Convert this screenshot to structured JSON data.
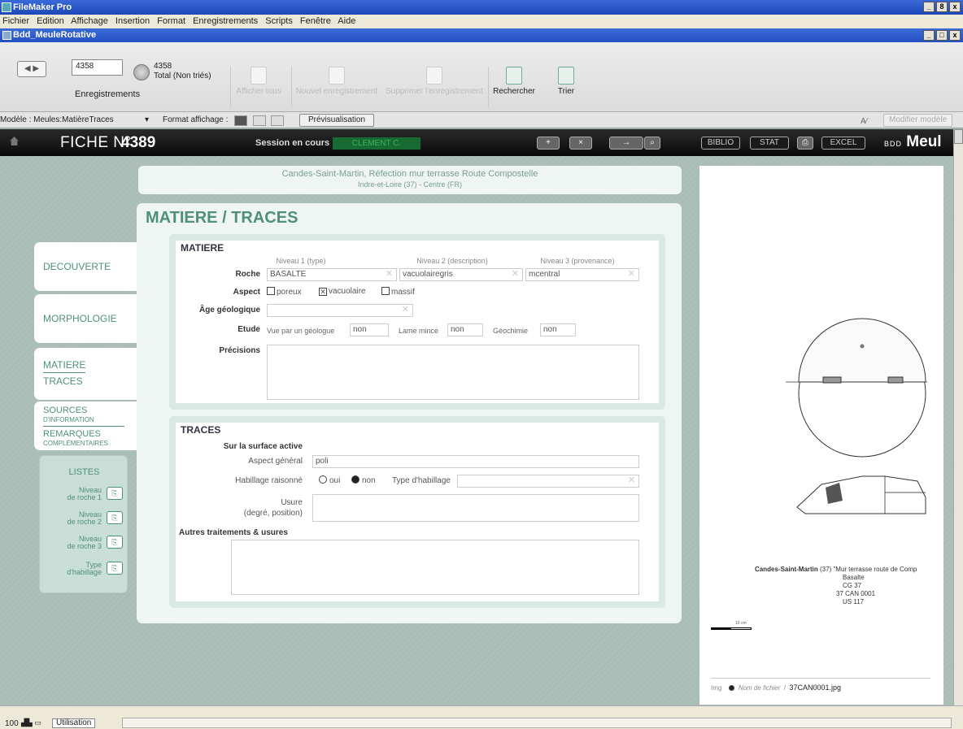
{
  "app": {
    "title": "FileMaker Pro",
    "window_controls": [
      "_",
      "8",
      "x"
    ]
  },
  "menu": [
    "Fichier",
    "Edition",
    "Affichage",
    "Insertion",
    "Format",
    "Enregistrements",
    "Scripts",
    "Fenêtre",
    "Aide"
  ],
  "document": {
    "title": "Bdd_MeuleRotative",
    "window_controls": [
      "_",
      "□",
      "x"
    ]
  },
  "toolbar": {
    "record_input": "4358",
    "records_label": "Enregistrements",
    "total_count": "4358",
    "total_label": "Total (Non triés)",
    "buttons": [
      "Afficher tous",
      "Nouvel enregistrement",
      "Supprimer l'enregistrement",
      "Rechercher",
      "Trier"
    ]
  },
  "layoutbar": {
    "model_label": "Modèle : Meules:MatièreTraces",
    "format_label": "Format affichage :",
    "preview_button": "Prévisualisation",
    "aa_button": "A⁄",
    "edit_layout_button": "Modifier modèle"
  },
  "header": {
    "fiche_label": "FICHE N°",
    "fiche_number": "4389",
    "session_label": "Session en cours :",
    "session_value": "CLEMENT C.",
    "buttons": [
      "BIBLIO",
      "STAT",
      "EXCEL"
    ],
    "brand_prefix": "BDD",
    "brand": "Meul"
  },
  "location": {
    "line1": "Candes-Saint-Martin, Réfection mur terrasse Route Compostelle",
    "line2": "Indre-et-Loire (37) - Centre (FR)"
  },
  "nav": {
    "decouverte": "DECOUVERTE",
    "morphologie": "MORPHOLOGIE",
    "matiere": "MATIERE",
    "traces": "TRACES",
    "sources": "SOURCES",
    "sources_sub": "D'INFORMATION",
    "remarques": "REMARQUES",
    "remarques_sub": "COMPLÉMENTAIRES"
  },
  "listes": {
    "title": "LISTES",
    "items": [
      {
        "line1": "Niveau",
        "line2": "de roche 1"
      },
      {
        "line1": "Niveau",
        "line2": "de roche 2"
      },
      {
        "line1": "Niveau",
        "line2": "de roche 3"
      },
      {
        "line1": "Type",
        "line2": "d'habillage"
      }
    ]
  },
  "page": {
    "title": "MATIERE / TRACES"
  },
  "matiere": {
    "heading": "MATIERE",
    "col1": "Niveau 1 (type)",
    "col2": "Niveau 2 (description)",
    "col3": "Niveau 3 (provenance)",
    "roche_label": "Roche",
    "roche1": "BASALTE",
    "roche2": "vacuolairegris",
    "roche3": "mcentral",
    "aspect_label": "Aspect",
    "aspect_options": [
      {
        "label": "poreux",
        "checked": false
      },
      {
        "label": "vacuolaire",
        "checked": true
      },
      {
        "label": "massif",
        "checked": false
      }
    ],
    "age_label": "Âge géologique",
    "age_value": "",
    "etude_label": "Etude",
    "geologue_label": "Vue par un géologue",
    "geologue_value": "non",
    "lame_label": "Lame mince",
    "lame_value": "non",
    "geochimie_label": "Géochimie",
    "geochimie_value": "non",
    "precisions_label": "Précisions",
    "precisions_value": ""
  },
  "traces": {
    "heading": "TRACES",
    "surface_label": "Sur la surface active",
    "aspect_general_label": "Aspect général",
    "aspect_general_value": "poli",
    "habillage_label": "Habillage raisonné",
    "habillage_oui": "oui",
    "habillage_non": "non",
    "habillage_selected": "non",
    "type_habillage_label": "Type d'habillage",
    "type_habillage_value": "",
    "usure_label": "Usure",
    "usure_sub": "(degré, position)",
    "usure_value": "",
    "autres_label": "Autres traitements & usures",
    "autres_value": ""
  },
  "image": {
    "caption_site": "Candes-Saint-Martin",
    "caption_rest": " (37) \"Mur terrasse route de Comp",
    "caption_lines": [
      "Basalte",
      "CG 37",
      "37 CAN 0001",
      "US 117"
    ],
    "scale_label": "10 cm",
    "footer_prefix": "Img",
    "footer_label": "Nom de fichier",
    "filename": "37CAN0001.jpg"
  },
  "statusbar": {
    "zoom": "100",
    "mode": "Utilisation"
  },
  "colors": {
    "accent": "#4f8f7c",
    "background": "#a9bcb6",
    "panel": "#eef5f2",
    "session_green": "#186a33"
  }
}
